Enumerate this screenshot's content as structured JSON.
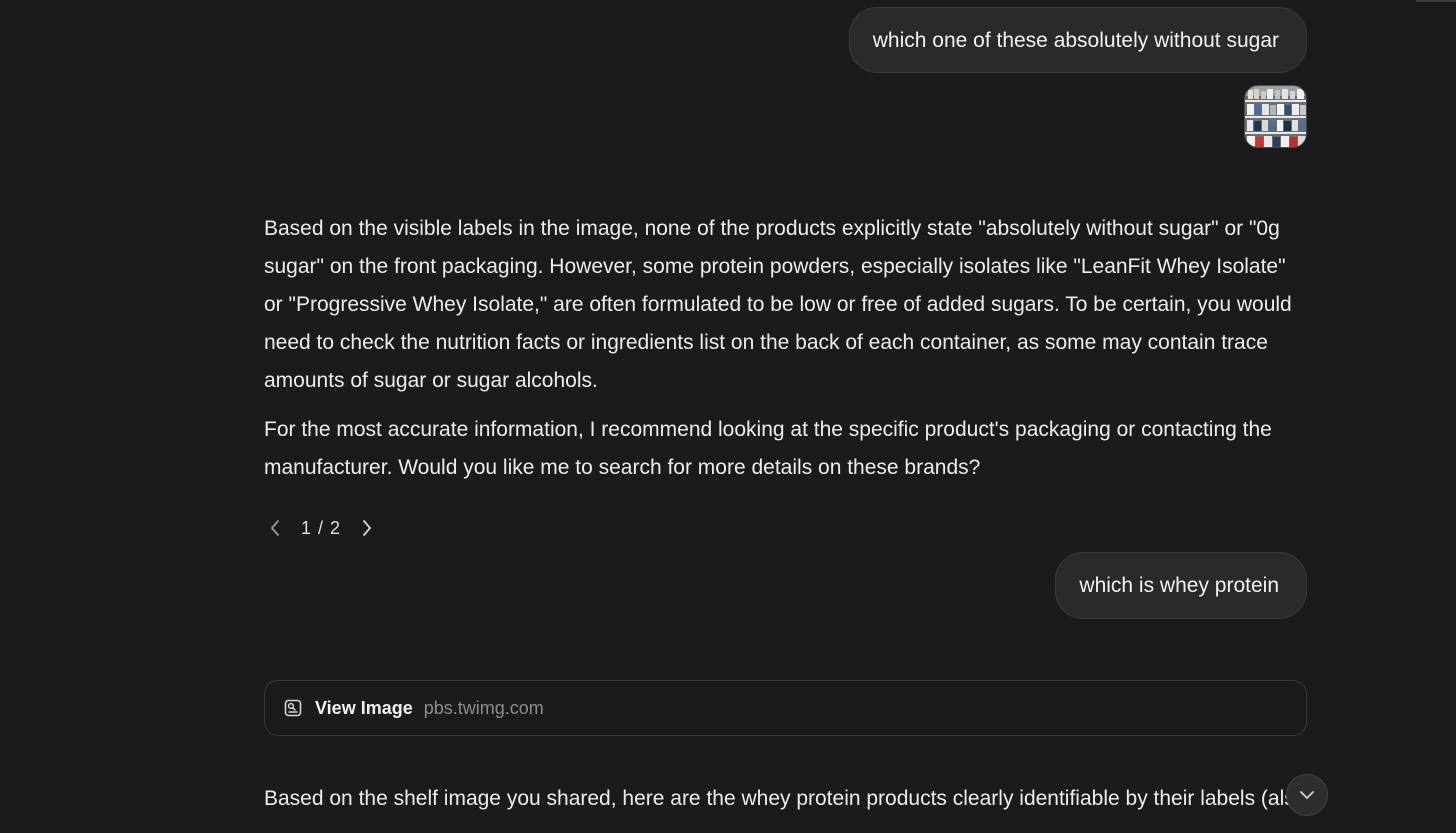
{
  "conversation": {
    "user_messages": [
      {
        "text": "which one of these absolutely without sugar"
      },
      {
        "text": "which is whey protein"
      }
    ],
    "attachment": {
      "icon": "shelf-photo-thumbnail"
    },
    "assistant_response_1": {
      "paragraph_1": "Based on the visible labels in the image, none of the products explicitly state \"absolutely without sugar\" or \"0g sugar\" on the front packaging. However, some protein powders, especially isolates like \"LeanFit Whey Isolate\" or \"Progressive Whey Isolate,\" are often formulated to be low or free of added sugars. To be certain, you would need to check the nutrition facts or ingredients list on the back of each container, as some may contain trace amounts of sugar or sugar alcohols.",
      "paragraph_2": "For the most accurate information, I recommend looking at the specific product's packaging or contacting the manufacturer. Would you like me to search for more details on these brands?",
      "pager": {
        "current": 1,
        "total": 2,
        "label": "1 / 2"
      }
    },
    "source_card": {
      "title": "View Image",
      "domain": "pbs.twimg.com",
      "icon": "image-search-icon"
    },
    "assistant_response_2": {
      "paragraph_1": "Based on the shelf image you shared, here are the whey protein products clearly identifiable by their labels (also, I will only include containers where \"whey\" is explicitly mentioned). I've focused on the most"
    }
  },
  "colors": {
    "background": "#1b1b1b",
    "bubble": "#2a2a2a",
    "text": "#ececec",
    "muted": "#8e8e8e"
  }
}
